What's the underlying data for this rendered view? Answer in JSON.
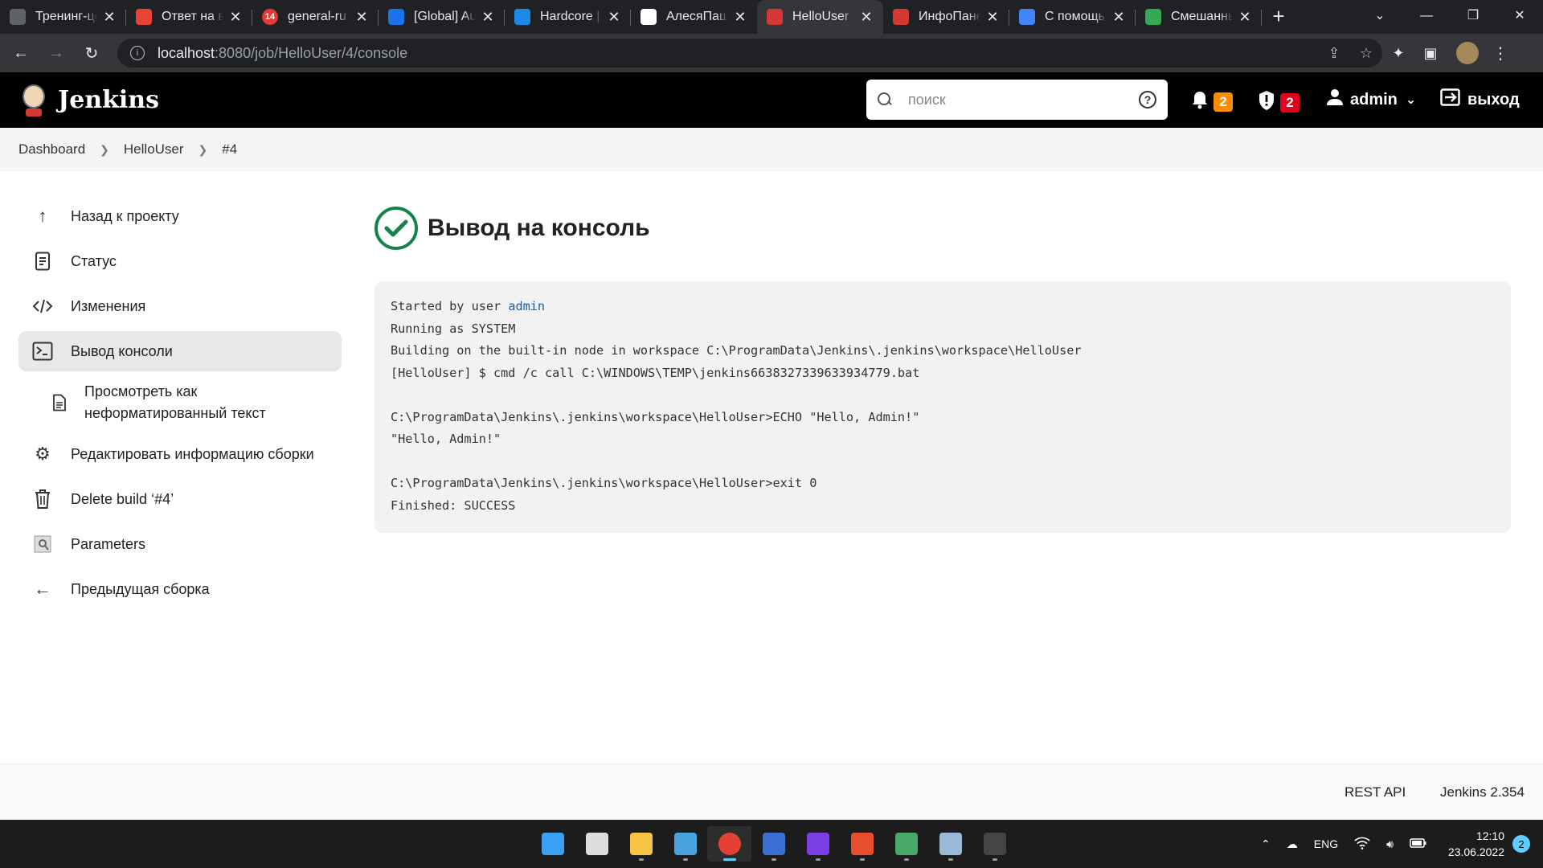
{
  "browser": {
    "tabs": [
      {
        "title": "Тренинг-це",
        "favicon": "graduation-cap-icon",
        "color": "#5f6368"
      },
      {
        "title": "Ответ на в",
        "favicon": "gmail-icon",
        "color": "#ea4335"
      },
      {
        "title": "general-ru",
        "favicon": "chat-icon",
        "color": "#e53935",
        "badge": "14"
      },
      {
        "title": "[Global] Au",
        "favicon": "doc-icon",
        "color": "#1a73e8"
      },
      {
        "title": "Hardcore | ",
        "favicon": "circle-icon",
        "color": "#1e88e5"
      },
      {
        "title": "АлесяПашк",
        "favicon": "github-icon",
        "color": "#ffffff"
      },
      {
        "title": "HelloUser #",
        "favicon": "jenkins-icon",
        "color": "#d33833",
        "active": true
      },
      {
        "title": "ИнфоПане",
        "favicon": "jenkins-icon",
        "color": "#d33833"
      },
      {
        "title": "С помощь",
        "favicon": "google-icon",
        "color": "#4285f4"
      },
      {
        "title": "Смешанны",
        "favicon": "page-icon",
        "color": "#34a853"
      }
    ],
    "url_host": "localhost",
    "url_path": ":8080/job/HelloUser/4/console"
  },
  "jenkins": {
    "brand": "Jenkins",
    "search_placeholder": "поиск",
    "notifications_count": "2",
    "security_count": "2",
    "user": "admin",
    "logout": "выход"
  },
  "breadcrumb": [
    "Dashboard",
    "HelloUser",
    "#4"
  ],
  "sidebar": [
    {
      "label": "Назад к проекту",
      "icon": "arrow-up-icon"
    },
    {
      "label": "Статус",
      "icon": "document-icon"
    },
    {
      "label": "Изменения",
      "icon": "code-icon"
    },
    {
      "label": "Вывод консоли",
      "icon": "terminal-icon",
      "active": true
    },
    {
      "label": "Просмотреть как неформатированный текст",
      "icon": "file-text-icon",
      "sub": true
    },
    {
      "label": "Редактировать информацию сборки",
      "icon": "gear-icon"
    },
    {
      "label": "Delete build ‘#4’",
      "icon": "trash-icon"
    },
    {
      "label": "Parameters",
      "icon": "parameters-icon"
    },
    {
      "label": "Предыдущая сборка",
      "icon": "arrow-left-icon"
    }
  ],
  "main": {
    "title": "Вывод на консоль",
    "status": "success",
    "status_color": "#138347",
    "console": {
      "line1_prefix": "Started by user ",
      "line1_link": "admin",
      "lines": [
        "Running as SYSTEM",
        "Building on the built-in node in workspace C:\\ProgramData\\Jenkins\\.jenkins\\workspace\\HelloUser",
        "[HelloUser] $ cmd /c call C:\\WINDOWS\\TEMP\\jenkins6638327339633934779.bat",
        "",
        "C:\\ProgramData\\Jenkins\\.jenkins\\workspace\\HelloUser>ECHO \"Hello, Admin!\"",
        "\"Hello, Admin!\"",
        "",
        "C:\\ProgramData\\Jenkins\\.jenkins\\workspace\\HelloUser>exit 0",
        "Finished: SUCCESS"
      ]
    }
  },
  "footer": {
    "rest_api": "REST API",
    "version": "Jenkins 2.354"
  },
  "taskbar": {
    "apps": [
      {
        "name": "windows-start-icon",
        "color": "#3aa0f3"
      },
      {
        "name": "search-icon",
        "color": "#dddddd"
      },
      {
        "name": "file-explorer-icon",
        "color": "#f6c342"
      },
      {
        "name": "microsoft-store-icon",
        "color": "#4aa3df"
      },
      {
        "name": "chrome-icon",
        "color": "#e34133",
        "active": true
      },
      {
        "name": "save-app-icon",
        "color": "#3b6fd1"
      },
      {
        "name": "intellij-icon",
        "color": "#7b3fe4"
      },
      {
        "name": "git-icon",
        "color": "#e94e31"
      },
      {
        "name": "git-gui-icon",
        "color": "#48a868"
      },
      {
        "name": "monitor-app-icon",
        "color": "#9ab8d8"
      },
      {
        "name": "terminal-app-icon",
        "color": "#444444"
      }
    ],
    "lang": "ENG",
    "time": "12:10",
    "date": "23.06.2022",
    "notifications": "2"
  }
}
